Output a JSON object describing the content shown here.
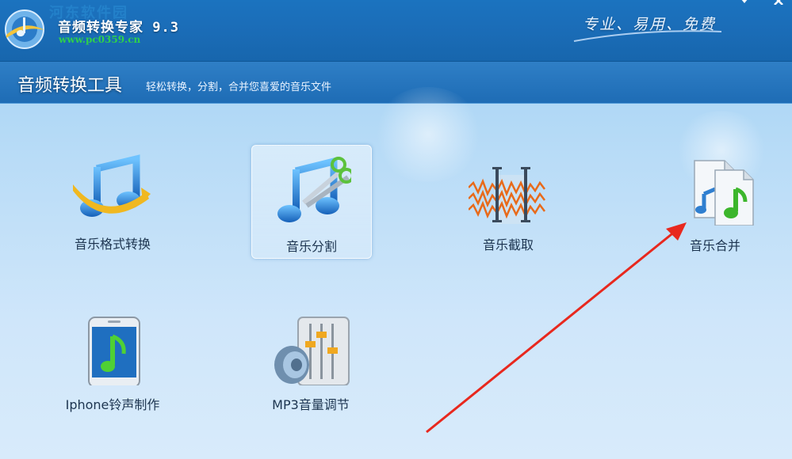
{
  "window": {
    "title": "音频转换专家 9.3",
    "watermark": "河东软件园",
    "url": "www.pc0359.cn",
    "slogan": "专业、易用、免费"
  },
  "banner": {
    "title": "音频转换工具",
    "subtitle": "轻松转换，分割，合并您喜爱的音乐文件"
  },
  "tools": [
    {
      "label": "音乐格式转换",
      "icon": "music-format-convert-icon"
    },
    {
      "label": "音乐分割",
      "icon": "music-split-icon",
      "selected": true
    },
    {
      "label": "音乐截取",
      "icon": "music-cut-icon"
    },
    {
      "label": "音乐合并",
      "icon": "music-merge-icon"
    },
    {
      "label": "Iphone铃声制作",
      "icon": "iphone-ringtone-icon"
    },
    {
      "label": "MP3音量调节",
      "icon": "mp3-volume-icon"
    }
  ],
  "colors": {
    "titlebar": "#1b6db8",
    "banner": "#2f7fc6",
    "annotation_arrow": "#e8281e"
  }
}
